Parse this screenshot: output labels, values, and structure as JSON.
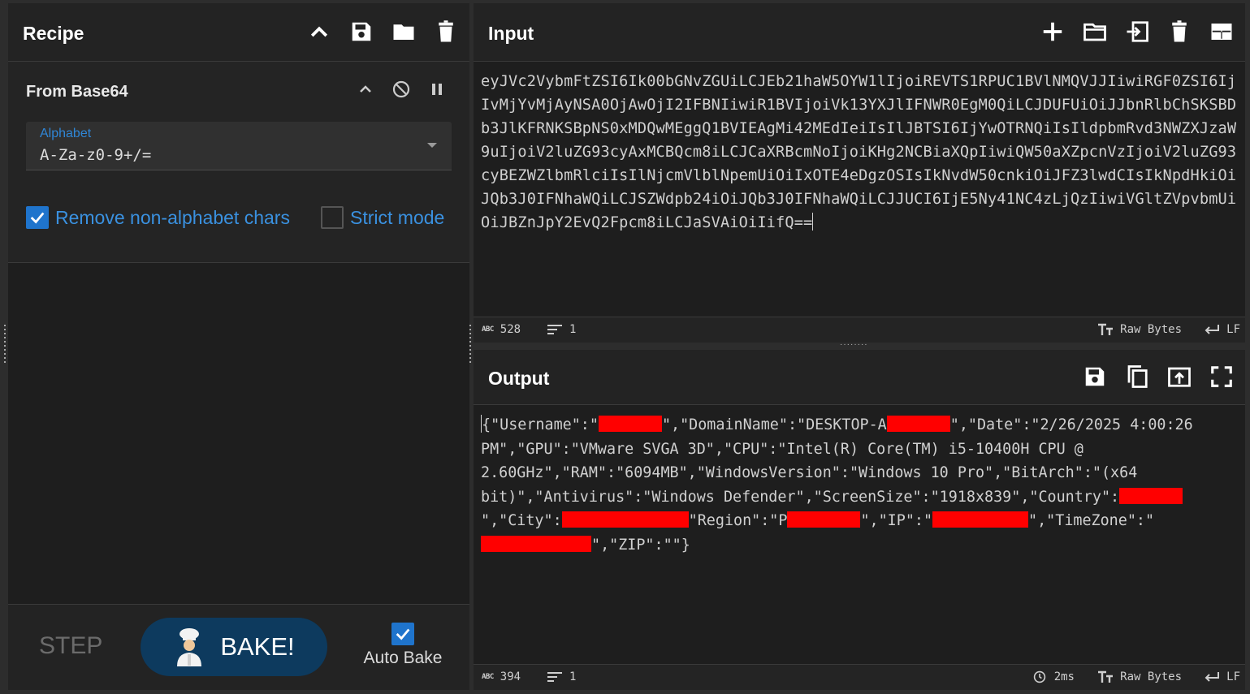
{
  "recipe": {
    "title": "Recipe",
    "operation": {
      "title": "From Base64",
      "alphabet_label": "Alphabet",
      "alphabet_value": "A-Za-z0-9+/=",
      "remove_non_alphabet_label": "Remove non-alphabet chars",
      "remove_non_alphabet_checked": true,
      "strict_mode_label": "Strict mode",
      "strict_mode_checked": false
    },
    "step_label": "STEP",
    "bake_label": "BAKE!",
    "auto_bake_label": "Auto Bake",
    "auto_bake_checked": true
  },
  "input": {
    "title": "Input",
    "text": "eyJVc2VybmFtZSI6Ik00bGNvZGUiLCJEb21haW5OYW1lIjoiREVTS1RPUC1BVlNMQVJJIiwiRGF0ZSI6IjIvMjYvMjAyNSA0OjAwOjI2IFBNIiwiR1BVIjoiVk13YXJlIFNWR0EgM0QiLCJDUFUiOiJJbnRlbChSKSBDb3JlKFRNKSBpNS0xMDQwMEggQ1BVIEAgMi42MEdIeiIsIlJBTSI6IjYwOTRNQiIsIldpbmRvd3NWZXJzaW9uIjoiV2luZG93cyAxMCBQcm8iLCJCaXRBcmNoIjoiKHg2NCBiaXQpIiwiQW50aXZpcnVzIjoiV2luZG93cyBEZWZlbmRlciIsIlNjcmVlblNpemUiOiIxOTE4eDgzOSIsIkNvdW50cnkiOiJFZ3lwdCIsIkNpdHkiOiJQb3J0IFNhaWQiLCJSZWdpb24iOiJQb3J0IFNhaWQiLCJJUCI6IjE5Ny41NC4zLjQzIiwiVGltZVpvbmUiOiJBZnJpY2EvQ2Fpcm8iLCJaSVAiOiIifQ==",
    "status": {
      "length": "528",
      "lines": "1",
      "encoding": "Raw Bytes",
      "eol": "LF"
    }
  },
  "output": {
    "title": "Output",
    "segments": {
      "s1": "{\"Username\":\"",
      "s2": "\",\"DomainName\":\"DESKTOP-A",
      "s3": "\",\"Date\":\"2/26/2025 4:00:26 PM\",\"GPU\":\"VMware SVGA 3D\",\"CPU\":\"Intel(R) Core(TM) i5-10400H CPU @ 2.60GHz\",\"RAM\":\"6094MB\",\"WindowsVersion\":\"Windows 10 Pro\",\"BitArch\":\"(x64 bit)\",\"Antivirus\":\"Windows Defender\",\"ScreenSize\":\"1918x839\",\"Country\":",
      "s4": "\",\"City\":",
      "s5": "\"Region\":\"P",
      "s6": "\",\"IP\":\"",
      "s7": "\",\"TimeZone\":\"",
      "s8": "\",\"ZIP\":\"\"}"
    },
    "status": {
      "length": "394",
      "lines": "1",
      "time": "2ms",
      "encoding": "Raw Bytes",
      "eol": "LF"
    }
  },
  "colors": {
    "accent": "#1f74cc",
    "bake_button": "#0d3a5e",
    "redaction": "#ff0000",
    "link_text": "#3a91e0"
  }
}
